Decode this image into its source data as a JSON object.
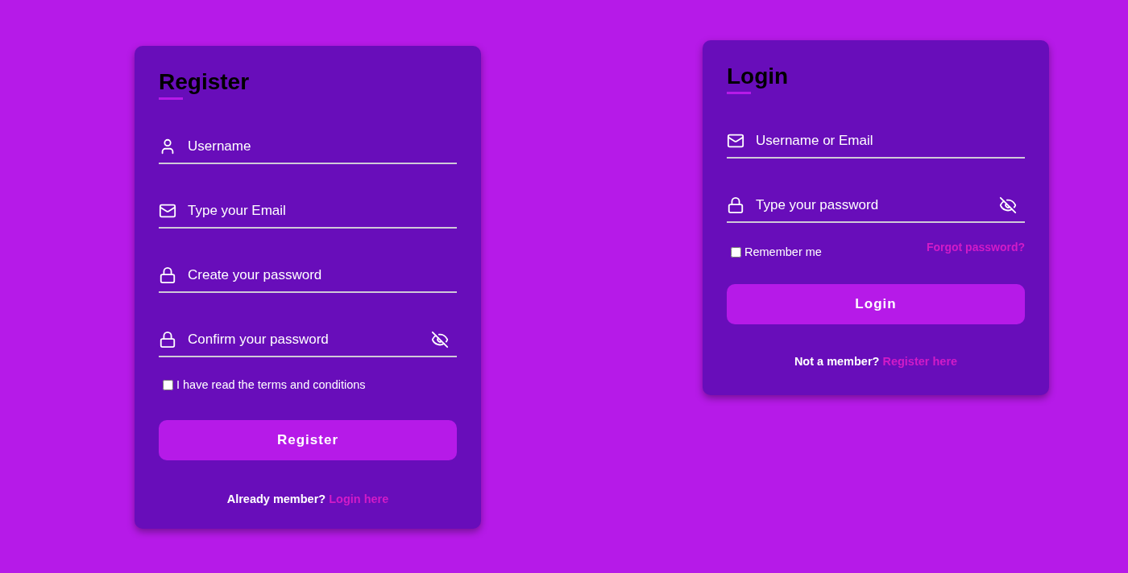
{
  "register": {
    "title": "Register",
    "fields": [
      {
        "kind": "user",
        "placeholder": "Username",
        "reveal_toggle": false
      },
      {
        "kind": "email",
        "placeholder": "Type your Email",
        "reveal_toggle": false
      },
      {
        "kind": "password",
        "placeholder": "Create your password",
        "reveal_toggle": false
      },
      {
        "kind": "password",
        "placeholder": "Confirm your password",
        "reveal_toggle": true
      }
    ],
    "checkbox": {
      "label": "I have read the terms and conditions",
      "checked": false
    },
    "button": "Register",
    "footer": {
      "text": "Already member?",
      "link": "Login here"
    }
  },
  "login": {
    "title": "Login",
    "fields": [
      {
        "kind": "email",
        "placeholder": "Username or Email",
        "reveal_toggle": false
      },
      {
        "kind": "password",
        "placeholder": "Type your password",
        "reveal_toggle": true
      }
    ],
    "checkbox": {
      "label": "Remember me",
      "checked": false
    },
    "forgot_link": "Forgot password?",
    "button": "Login",
    "footer": {
      "text": "Not a member?",
      "link": "Register here"
    }
  }
}
